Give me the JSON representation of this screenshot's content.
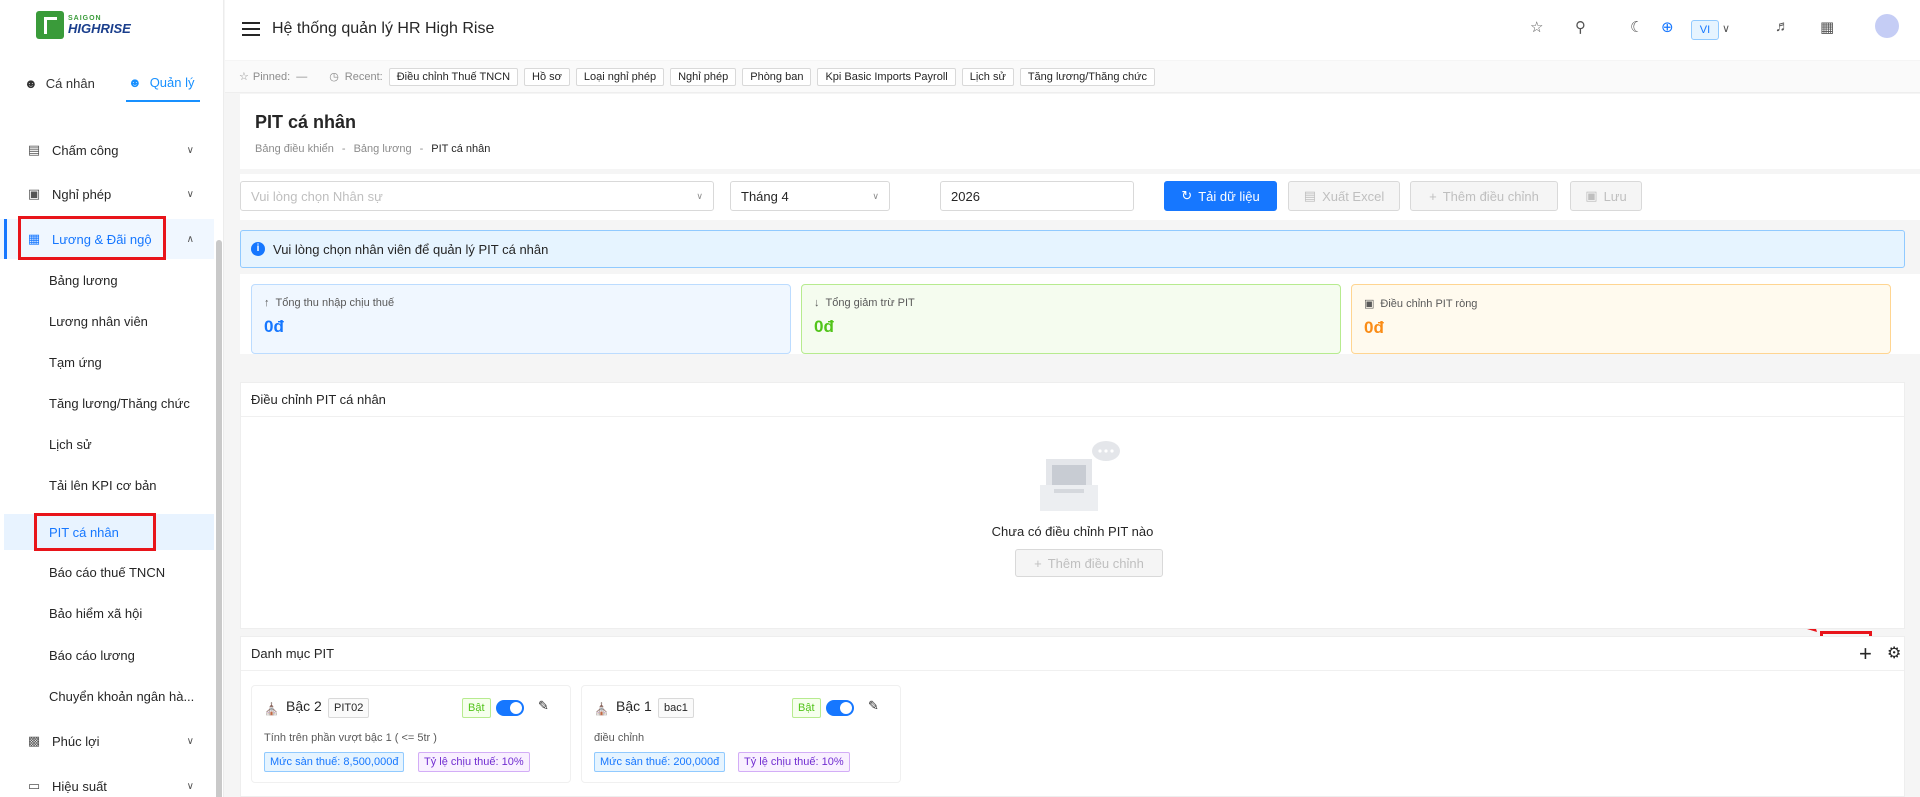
{
  "logo": {
    "small": "SAIGON",
    "big": "HIGHRISE"
  },
  "user_tabs": {
    "personal": "Cá nhân",
    "manage": "Quản lý"
  },
  "menu": {
    "attendance": "Chấm công",
    "leave": "Nghỉ phép",
    "salary": "Lương & Đãi ngộ",
    "benefits": "Phúc lợi",
    "performance": "Hiệu suất",
    "sub": [
      "Bảng lương",
      "Lương nhân viên",
      "Tạm ứng",
      "Tăng lương/Thăng chức",
      "Lịch sử",
      "Tải lên KPI cơ bản",
      "PIT cá nhân",
      "Báo cáo thuế TNCN",
      "Bảo hiểm xã hội",
      "Báo cáo lương",
      "Chuyển khoản ngân hà..."
    ]
  },
  "header": {
    "title": "Hệ thống quản lý HR High Rise",
    "lang": "VI"
  },
  "pinbar": {
    "pinned_label": "Pinned:",
    "pinned_value": "—",
    "recent_label": "Recent:",
    "recent": [
      "Điều chỉnh Thuế TNCN",
      "Hồ sơ",
      "Loại nghỉ phép",
      "Nghỉ phép",
      "Phòng ban",
      "Kpi Basic Imports Payroll",
      "Lịch sử",
      "Tăng lương/Thăng chức"
    ]
  },
  "page": {
    "title": "PIT cá nhân",
    "breadcrumb": [
      "Bảng điều khiển",
      "Bảng lương",
      "PIT cá nhân"
    ],
    "sep": "-"
  },
  "toolbar": {
    "employee_placeholder": "Vui lòng chọn Nhân sự",
    "month": "Tháng 4",
    "year": "2026",
    "load": "Tải dữ liệu",
    "export": "Xuất Excel",
    "add_adjust": "Thêm điều chỉnh",
    "save": "Lưu"
  },
  "alert": "Vui lòng chọn nhân viên để quản lý PIT cá nhân",
  "stats": [
    {
      "label": "Tổng thu nhập chịu thuế",
      "value": "0đ"
    },
    {
      "label": "Tổng giảm trừ PIT",
      "value": "0đ"
    },
    {
      "label": "Điều chỉnh PIT ròng",
      "value": "0đ"
    }
  ],
  "adjust_panel": {
    "title": "Điều chỉnh PIT cá nhân",
    "empty": "Chưa có điều chỉnh PIT nào",
    "add": "Thêm điều chỉnh"
  },
  "pit_panel": {
    "title": "Danh mục PIT",
    "cards": [
      {
        "name": "Bậc 2",
        "code": "PIT02",
        "status": "Bật",
        "desc": "Tính trên phần vượt bậc 1 ( <= 5tr )",
        "floor": "Mức sàn thuế: 8,500,000đ",
        "rate": "Tỷ lệ chịu thuế: 10%"
      },
      {
        "name": "Bậc 1",
        "code": "bac1",
        "status": "Bật",
        "desc": "điều chỉnh",
        "floor": "Mức sàn thuế: 200,000đ",
        "rate": "Tỷ lệ chịu thuế: 10%"
      }
    ]
  },
  "colors": {
    "primary": "#1677ff",
    "highlight": "#e8141a"
  }
}
